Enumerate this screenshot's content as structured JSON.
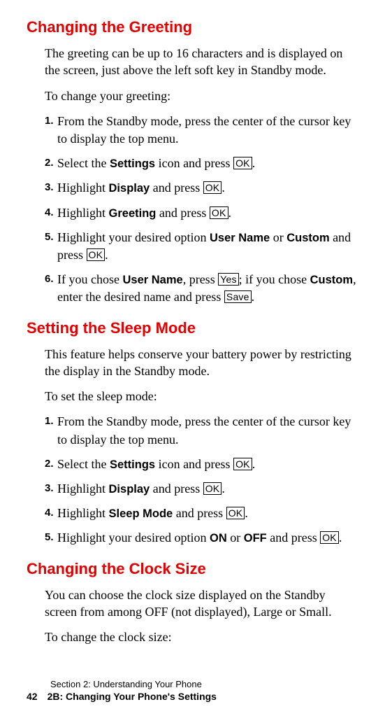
{
  "section1": {
    "heading": "Changing the Greeting",
    "p1": "The greeting can be up to 16 characters and is displayed on the screen, just above the left soft key in Standby mode.",
    "p2": "To change your greeting:",
    "steps": [
      {
        "num": "1.",
        "pre": "From the Standby mode, press the center of the cursor key to display the top menu."
      },
      {
        "num": "2.",
        "pre": "Select the ",
        "b1": "Settings",
        "mid1": " icon and press ",
        "key1": "OK",
        "post": "."
      },
      {
        "num": "3.",
        "pre": "Highlight ",
        "b1": "Display",
        "mid1": " and press ",
        "key1": "OK",
        "post": "."
      },
      {
        "num": "4.",
        "pre": "Highlight ",
        "b1": "Greeting",
        "mid1": " and press ",
        "key1": "OK",
        "post": "."
      },
      {
        "num": "5.",
        "pre": "Highlight your desired option ",
        "b1": "User Name",
        "mid1": " or ",
        "b2": "Custom",
        "mid2": " and press ",
        "key1": "OK",
        "post": "."
      },
      {
        "num": "6.",
        "pre": "If you chose ",
        "b1": "User Name",
        "mid1": ", press ",
        "key1": "Yes",
        "mid2": "; if you chose ",
        "b2": "Custom",
        "mid3": ", enter the desired name and press ",
        "key2": "Save",
        "post": "."
      }
    ]
  },
  "section2": {
    "heading": "Setting the Sleep Mode",
    "p1": "This feature helps conserve your battery power by restricting the display in the Standby mode.",
    "p2": "To set the sleep mode:",
    "steps": [
      {
        "num": "1.",
        "pre": "From the Standby mode, press the center of the cursor key to display the top menu."
      },
      {
        "num": "2.",
        "pre": "Select the ",
        "b1": "Settings",
        "mid1": " icon and press ",
        "key1": "OK",
        "post": "."
      },
      {
        "num": "3.",
        "pre": "Highlight ",
        "b1": "Display",
        "mid1": " and press ",
        "key1": "OK",
        "post": "."
      },
      {
        "num": "4.",
        "pre": "Highlight ",
        "b1": "Sleep Mode",
        "mid1": " and press ",
        "key1": "OK",
        "post": "."
      },
      {
        "num": "5.",
        "pre": "Highlight your desired option ",
        "b1": "ON",
        "mid1": " or ",
        "b2": "OFF",
        "mid2": " and press ",
        "key1": "OK",
        "post": "."
      }
    ]
  },
  "section3": {
    "heading": "Changing the Clock Size",
    "p1": "You can choose the clock size displayed on the Standby screen from among OFF (not displayed), Large or Small.",
    "p2": "To change the clock size:"
  },
  "footer": {
    "line1": "Section 2: Understanding Your Phone",
    "page": "42",
    "line2": "2B: Changing Your Phone's Settings"
  }
}
